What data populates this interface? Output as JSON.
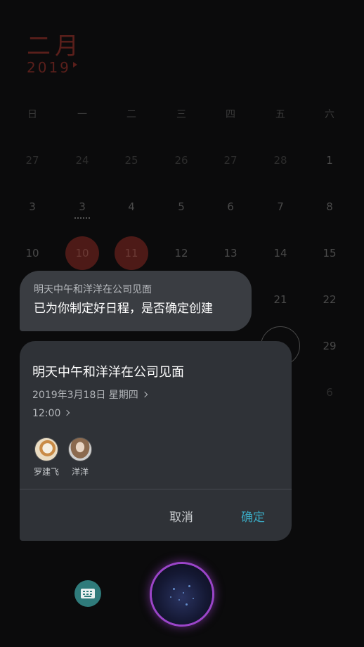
{
  "calendar": {
    "month": "二月",
    "year": "2019",
    "weekdays": [
      "日",
      "一",
      "二",
      "三",
      "四",
      "五",
      "六"
    ],
    "rows": [
      [
        "27",
        "24",
        "25",
        "26",
        "27",
        "28",
        "1"
      ],
      [
        "3",
        "3",
        "4",
        "5",
        "6",
        "7",
        "8"
      ],
      [
        "10",
        "10",
        "11",
        "12",
        "13",
        "14",
        "15"
      ],
      [
        "",
        "",
        "",
        "",
        "",
        "21",
        "22"
      ],
      [
        "",
        "",
        "",
        "",
        "",
        "",
        "29"
      ],
      [
        "",
        "",
        "",
        "",
        "",
        "",
        "6"
      ]
    ]
  },
  "bubble": {
    "query": "明天中午和洋洋在公司见面",
    "reply": "已为你制定好日程，是否确定创建"
  },
  "event": {
    "title": "明天中午和洋洋在公司见面",
    "date": "2019年3月18日   星期四",
    "time": "12:00",
    "attendees": [
      {
        "name": "罗建飞"
      },
      {
        "name": "洋洋"
      }
    ],
    "cancel_label": "取消",
    "confirm_label": "确定"
  },
  "colors": {
    "accent": "#3aa9c2",
    "card": "#2f3237",
    "orb_ring": "#9b45c9",
    "keyboard_button": "#2f7b7b"
  },
  "icons": {
    "keyboard": "keyboard-icon",
    "voice": "voice-orb-icon"
  }
}
